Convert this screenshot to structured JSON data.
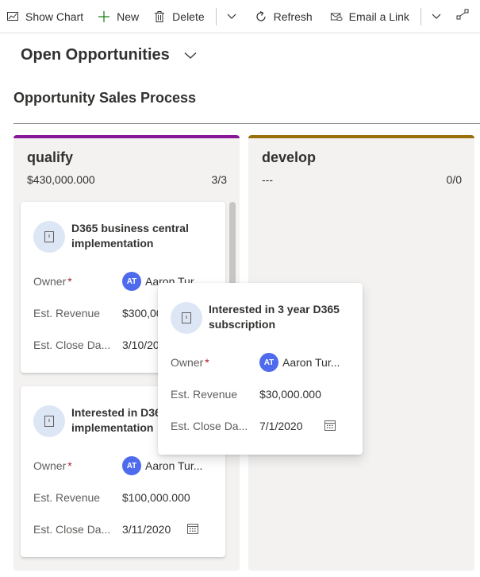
{
  "toolbar": {
    "show_chart": "Show Chart",
    "new": "New",
    "delete": "Delete",
    "refresh": "Refresh",
    "email_link": "Email a Link"
  },
  "view": {
    "title": "Open Opportunities"
  },
  "process": {
    "title": "Opportunity Sales Process"
  },
  "columns": [
    {
      "name": "qualify",
      "amount": "$430,000.000",
      "count": "3/3",
      "color": "#881798"
    },
    {
      "name": "develop",
      "amount": "---",
      "count": "0/0",
      "color": "#986f0b"
    }
  ],
  "labels": {
    "owner": "Owner",
    "required_mark": "*",
    "est_revenue": "Est. Revenue",
    "est_close": "Est. Close Da..."
  },
  "cards": [
    {
      "title": "D365 business central implementation",
      "owner_initials": "AT",
      "owner": "Aaron Tur",
      "revenue": "$300,00",
      "close_date": "3/10/20"
    },
    {
      "title": "Interested in D36 implementation",
      "owner_initials": "AT",
      "owner": "Aaron Tur...",
      "revenue": "$100,000.000",
      "close_date": "3/11/2020"
    },
    {
      "title": "Interested in 3 year D365 subscription",
      "owner_initials": "AT",
      "owner": "Aaron Tur...",
      "revenue": "$30,000.000",
      "close_date": "7/1/2020"
    }
  ],
  "icons": {
    "show_chart": "chart-icon",
    "new": "plus-icon",
    "delete": "trash-icon",
    "refresh": "refresh-icon",
    "email_link": "email-link-icon",
    "flow": "flow-icon",
    "entity": "opportunity-icon",
    "calendar": "calendar-icon"
  }
}
